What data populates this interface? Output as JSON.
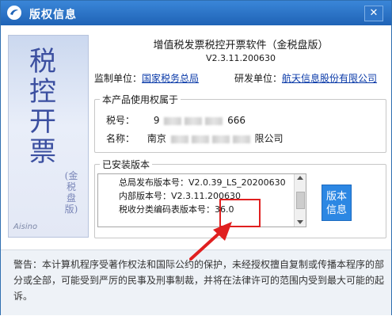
{
  "window": {
    "title": "版权信息",
    "close": "✕"
  },
  "banner": {
    "title_chars": [
      "税",
      "控",
      "开",
      "票"
    ],
    "sub": "(金税盘版)",
    "brand": "Aisino"
  },
  "product": {
    "name": "增值税发票税控开票软件（金税盘版）",
    "version": "V2.3.11.200630"
  },
  "supervisor": {
    "label": "监制单位：",
    "value": "国家税务总局"
  },
  "developer": {
    "label": "研发单位：",
    "value": "航天信息股份有限公司"
  },
  "owner_group": {
    "title": "本产品使用权属于",
    "tax_label": "税号：",
    "tax_value_prefix": "9",
    "tax_value_suffix": "666",
    "name_label": "名称：",
    "name_value_prefix": "南京",
    "name_value_suffix": "限公司"
  },
  "installed_group": {
    "title": "已安装版本",
    "lines": [
      "总局发布版本号：V2.0.39_LS_20200630",
      "内部版本号：V2.3.11.200630",
      "税收分类编码表版本号：36.0"
    ]
  },
  "version_button": {
    "line1": "版本",
    "line2": "信息"
  },
  "warning": "警告：本计算机程序受著作权法和国际公约的保护，未经授权擅自复制或传播本程序的部分或全部，可能受到严厉的民事及刑事制裁，并将在法律许可的范围内受到最大可能的起诉。",
  "colors": {
    "titlebar": "#2a74c8",
    "accent_button": "#2c87e3",
    "highlight": "#e02020",
    "link": "#0a3aa8"
  }
}
